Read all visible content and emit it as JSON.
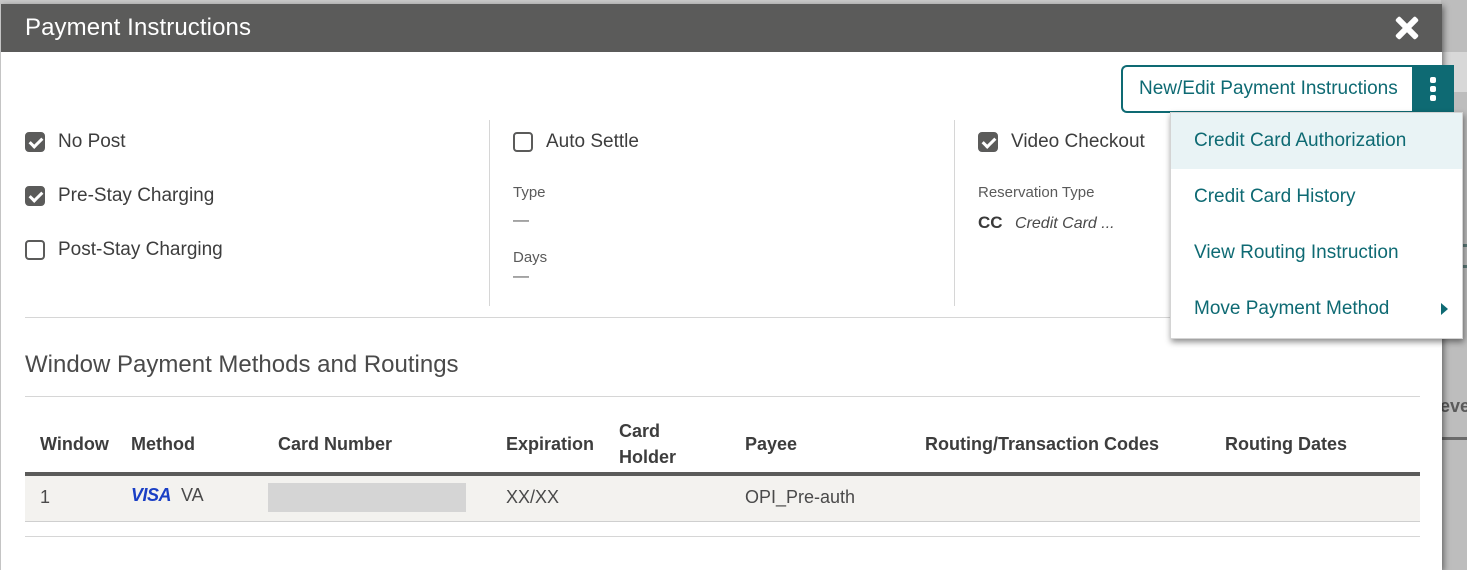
{
  "dialog": {
    "title": "Payment Instructions",
    "close_icon": "close-icon"
  },
  "actions": {
    "new_edit_label": "New/Edit Payment Instructions",
    "more_icon": "kebab-vertical-icon"
  },
  "menu": {
    "items": [
      {
        "label": "Credit Card Authorization",
        "highlighted": true
      },
      {
        "label": "Credit Card History"
      },
      {
        "label": "View Routing Instruction"
      },
      {
        "label": "Move Payment Method",
        "has_submenu": true
      }
    ]
  },
  "options": {
    "col1": [
      {
        "label": "No Post",
        "checked": true
      },
      {
        "label": "Pre-Stay Charging",
        "checked": true
      },
      {
        "label": "Post-Stay Charging",
        "checked": false
      }
    ],
    "auto_settle": {
      "label": "Auto Settle",
      "checked": false
    },
    "type_label": "Type",
    "type_value": "—",
    "days_label": "Days",
    "days_value": "—",
    "video_checkout": {
      "label": "Video Checkout",
      "checked": true
    },
    "reservation_type_label": "Reservation Type",
    "reservation_type_code": "CC",
    "reservation_type_desc": "Credit Card ..."
  },
  "section": {
    "title": "Window Payment Methods and Routings"
  },
  "table": {
    "headers": {
      "window": "Window",
      "method": "Method",
      "card_number": "Card Number",
      "expiration": "Expiration",
      "card_holder_1": "Card",
      "card_holder_2": "Holder",
      "payee": "Payee",
      "routing_codes": "Routing/Transaction Codes",
      "routing_dates": "Routing Dates"
    },
    "rows": [
      {
        "window": "1",
        "method_brand": "VISA",
        "method_code": "VA",
        "card_number": "",
        "expiration": "XX/XX",
        "card_holder": "",
        "payee": "OPI_Pre-auth",
        "routing_codes": "",
        "routing_dates": ""
      }
    ]
  },
  "background": {
    "partial_text": "eve"
  },
  "colors": {
    "accent": "#0e6a73",
    "titlebar": "#5b5b5a",
    "menu_highlight": "#e9f3f5",
    "visa_blue": "#1a3fc5",
    "row_bg": "#f3f2ef"
  }
}
